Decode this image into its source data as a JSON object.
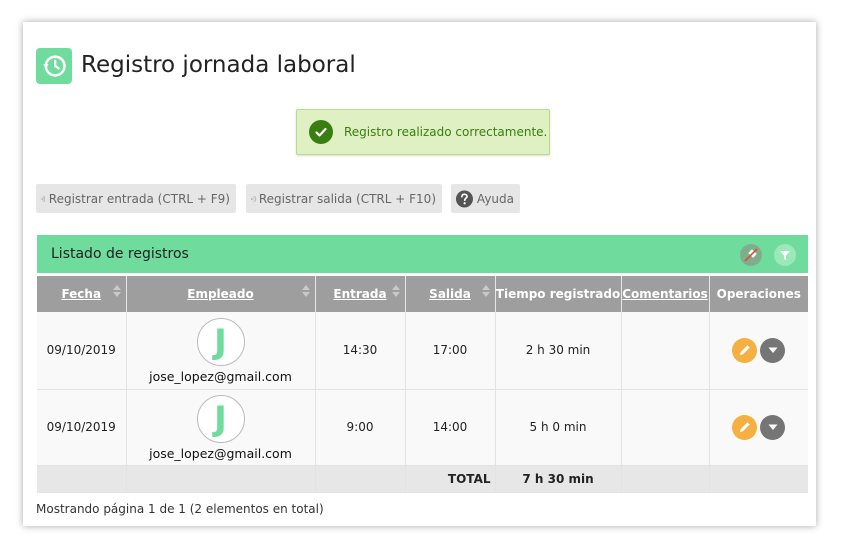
{
  "page": {
    "title": "Registro jornada laboral",
    "title_icon": "history-clock-icon",
    "accent_color": "#6fdb9c"
  },
  "alert": {
    "message": "Registro realizado correctamente.",
    "icon": "check-circle-icon",
    "color": "#3a7d12"
  },
  "toolbar": {
    "entrada_label": "Registrar entrada (CTRL + F9)",
    "salida_label": "Registrar salida (CTRL + F10)",
    "ayuda_label": "Ayuda"
  },
  "list": {
    "title": "Listado de registros",
    "columns": [
      "Fecha",
      "Empleado",
      "Entrada",
      "Salida",
      "Tiempo registrado",
      "Comentarios",
      "Operaciones"
    ],
    "rows": [
      {
        "fecha": "09/10/2019",
        "avatar_letter": "J",
        "empleado": "jose_lopez@gmail.com",
        "entrada": "14:30",
        "salida": "17:00",
        "tiempo": "2 h 30 min",
        "comentarios": ""
      },
      {
        "fecha": "09/10/2019",
        "avatar_letter": "J",
        "empleado": "jose_lopez@gmail.com",
        "entrada": "9:00",
        "salida": "14:00",
        "tiempo": "5 h 0 min",
        "comentarios": ""
      }
    ],
    "total_label": "TOTAL",
    "total_value": "7 h 30 min"
  },
  "footer": {
    "pagination": "Mostrando página 1 de 1 (2 elementos en total)"
  }
}
